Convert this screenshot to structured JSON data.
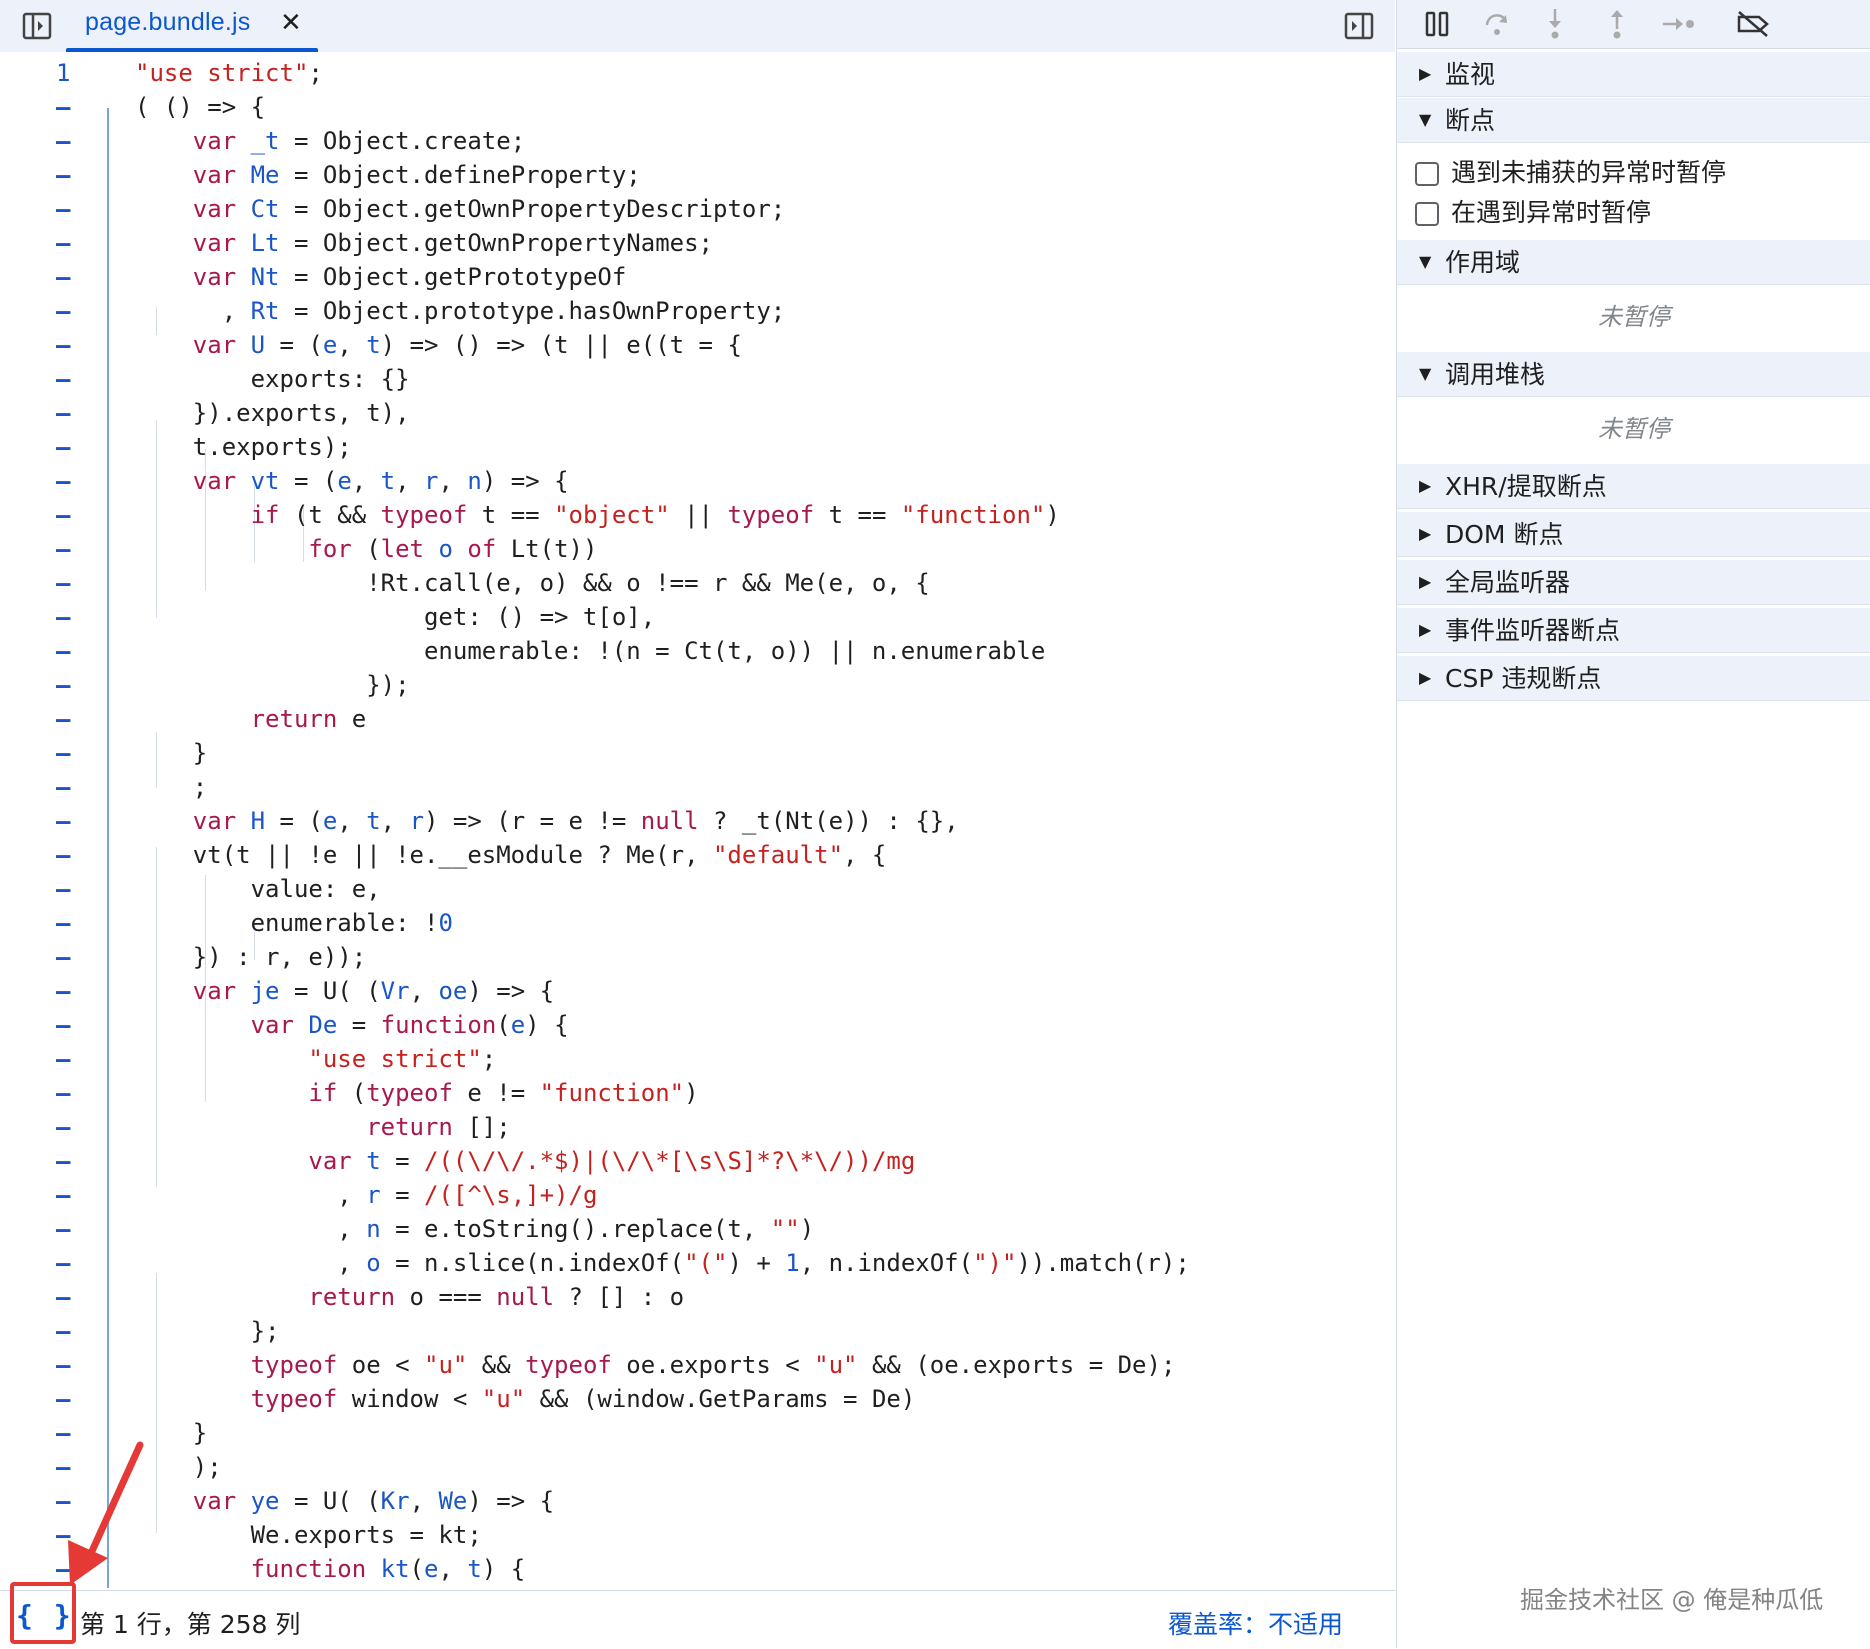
{
  "editor": {
    "tab_title": "page.bundle.js",
    "tab_close": "✕",
    "pretty_print": "{ }",
    "cursor_position": "第 1 行，第 258 列",
    "coverage": "覆盖率：不适用"
  },
  "code": {
    "first_line_number": "1",
    "fold_marker": "–",
    "lines": [
      [
        [
          "str",
          "\"use strict\""
        ],
        [
          "p",
          ";"
        ]
      ],
      [
        [
          "p",
          "( () => {"
        ]
      ],
      [
        [
          "p",
          "    "
        ],
        [
          "kw",
          "var"
        ],
        [
          "p",
          " "
        ],
        [
          "v",
          "_t"
        ],
        [
          "p",
          " = Object.create;"
        ]
      ],
      [
        [
          "p",
          "    "
        ],
        [
          "kw",
          "var"
        ],
        [
          "p",
          " "
        ],
        [
          "v",
          "Me"
        ],
        [
          "p",
          " = Object.defineProperty;"
        ]
      ],
      [
        [
          "p",
          "    "
        ],
        [
          "kw",
          "var"
        ],
        [
          "p",
          " "
        ],
        [
          "v",
          "Ct"
        ],
        [
          "p",
          " = Object.getOwnPropertyDescriptor;"
        ]
      ],
      [
        [
          "p",
          "    "
        ],
        [
          "kw",
          "var"
        ],
        [
          "p",
          " "
        ],
        [
          "v",
          "Lt"
        ],
        [
          "p",
          " = Object.getOwnPropertyNames;"
        ]
      ],
      [
        [
          "p",
          "    "
        ],
        [
          "kw",
          "var"
        ],
        [
          "p",
          " "
        ],
        [
          "v",
          "Nt"
        ],
        [
          "p",
          " = Object.getPrototypeOf"
        ]
      ],
      [
        [
          "p",
          "      , "
        ],
        [
          "v",
          "Rt"
        ],
        [
          "p",
          " = Object.prototype.hasOwnProperty;"
        ]
      ],
      [
        [
          "p",
          "    "
        ],
        [
          "kw",
          "var"
        ],
        [
          "p",
          " "
        ],
        [
          "v",
          "U"
        ],
        [
          "p",
          " = ("
        ],
        [
          "v",
          "e"
        ],
        [
          "p",
          ", "
        ],
        [
          "v",
          "t"
        ],
        [
          "p",
          ") => () => (t || e((t = {"
        ]
      ],
      [
        [
          "p",
          "        exports: {}"
        ]
      ],
      [
        [
          "p",
          "    }).exports, t),"
        ]
      ],
      [
        [
          "p",
          "    t.exports);"
        ]
      ],
      [
        [
          "p",
          "    "
        ],
        [
          "kw",
          "var"
        ],
        [
          "p",
          " "
        ],
        [
          "v",
          "vt"
        ],
        [
          "p",
          " = ("
        ],
        [
          "v",
          "e"
        ],
        [
          "p",
          ", "
        ],
        [
          "v",
          "t"
        ],
        [
          "p",
          ", "
        ],
        [
          "v",
          "r"
        ],
        [
          "p",
          ", "
        ],
        [
          "v",
          "n"
        ],
        [
          "p",
          ") => {"
        ]
      ],
      [
        [
          "p",
          "        "
        ],
        [
          "kw",
          "if"
        ],
        [
          "p",
          " (t && "
        ],
        [
          "kw",
          "typeof"
        ],
        [
          "p",
          " t == "
        ],
        [
          "str",
          "\"object\""
        ],
        [
          "p",
          " || "
        ],
        [
          "kw",
          "typeof"
        ],
        [
          "p",
          " t == "
        ],
        [
          "str",
          "\"function\""
        ],
        [
          "p",
          ")"
        ]
      ],
      [
        [
          "p",
          "            "
        ],
        [
          "kw",
          "for"
        ],
        [
          "p",
          " ("
        ],
        [
          "kw",
          "let"
        ],
        [
          "p",
          " "
        ],
        [
          "v",
          "o"
        ],
        [
          "p",
          " "
        ],
        [
          "kw",
          "of"
        ],
        [
          "p",
          " Lt(t))"
        ]
      ],
      [
        [
          "p",
          "                !Rt.call(e, o) && o !== r && Me(e, o, {"
        ]
      ],
      [
        [
          "p",
          "                    get: () => t[o],"
        ]
      ],
      [
        [
          "p",
          "                    enumerable: !(n = Ct(t, o)) || n.enumerable"
        ]
      ],
      [
        [
          "p",
          "                });"
        ]
      ],
      [
        [
          "p",
          "        "
        ],
        [
          "kw",
          "return"
        ],
        [
          "p",
          " e"
        ]
      ],
      [
        [
          "p",
          "    }"
        ]
      ],
      [
        [
          "p",
          "    ;"
        ]
      ],
      [
        [
          "p",
          "    "
        ],
        [
          "kw",
          "var"
        ],
        [
          "p",
          " "
        ],
        [
          "v",
          "H"
        ],
        [
          "p",
          " = ("
        ],
        [
          "v",
          "e"
        ],
        [
          "p",
          ", "
        ],
        [
          "v",
          "t"
        ],
        [
          "p",
          ", "
        ],
        [
          "v",
          "r"
        ],
        [
          "p",
          ") => (r = e != "
        ],
        [
          "kw",
          "null"
        ],
        [
          "p",
          " ? _t(Nt(e)) : {},"
        ]
      ],
      [
        [
          "p",
          "    vt(t || !e || !e.__esModule ? Me(r, "
        ],
        [
          "str",
          "\"default\""
        ],
        [
          "p",
          ", {"
        ]
      ],
      [
        [
          "p",
          "        value: e,"
        ]
      ],
      [
        [
          "p",
          "        enumerable: !"
        ],
        [
          "num",
          "0"
        ]
      ],
      [
        [
          "p",
          "    }) : r, e));"
        ]
      ],
      [
        [
          "p",
          "    "
        ],
        [
          "kw",
          "var"
        ],
        [
          "p",
          " "
        ],
        [
          "v",
          "je"
        ],
        [
          "p",
          " = U( ("
        ],
        [
          "v",
          "Vr"
        ],
        [
          "p",
          ", "
        ],
        [
          "v",
          "oe"
        ],
        [
          "p",
          ") => {"
        ]
      ],
      [
        [
          "p",
          "        "
        ],
        [
          "kw",
          "var"
        ],
        [
          "p",
          " "
        ],
        [
          "v",
          "De"
        ],
        [
          "p",
          " = "
        ],
        [
          "kw",
          "function"
        ],
        [
          "p",
          "("
        ],
        [
          "v",
          "e"
        ],
        [
          "p",
          ") {"
        ]
      ],
      [
        [
          "p",
          "            "
        ],
        [
          "str",
          "\"use strict\""
        ],
        [
          "p",
          ";"
        ]
      ],
      [
        [
          "p",
          "            "
        ],
        [
          "kw",
          "if"
        ],
        [
          "p",
          " ("
        ],
        [
          "kw",
          "typeof"
        ],
        [
          "p",
          " e != "
        ],
        [
          "str",
          "\"function\""
        ],
        [
          "p",
          ")"
        ]
      ],
      [
        [
          "p",
          "                "
        ],
        [
          "kw",
          "return"
        ],
        [
          "p",
          " [];"
        ]
      ],
      [
        [
          "p",
          "            "
        ],
        [
          "kw",
          "var"
        ],
        [
          "p",
          " "
        ],
        [
          "v",
          "t"
        ],
        [
          "p",
          " = "
        ],
        [
          "str",
          "/((\\/\\/.*$)|(\\/\\*[\\s\\S]*?\\*\\/))/mg"
        ]
      ],
      [
        [
          "p",
          "              , "
        ],
        [
          "v",
          "r"
        ],
        [
          "p",
          " = "
        ],
        [
          "str",
          "/([^\\s,]+)/g"
        ]
      ],
      [
        [
          "p",
          "              , "
        ],
        [
          "v",
          "n"
        ],
        [
          "p",
          " = e.toString().replace(t, "
        ],
        [
          "str",
          "\"\""
        ],
        [
          "p",
          ")"
        ]
      ],
      [
        [
          "p",
          "              , "
        ],
        [
          "v",
          "o"
        ],
        [
          "p",
          " = n.slice(n.indexOf("
        ],
        [
          "str",
          "\"(\""
        ],
        [
          "p",
          ") + "
        ],
        [
          "num",
          "1"
        ],
        [
          "p",
          ", n.indexOf("
        ],
        [
          "str",
          "\")\""
        ],
        [
          "p",
          ")).match(r);"
        ]
      ],
      [
        [
          "p",
          "            "
        ],
        [
          "kw",
          "return"
        ],
        [
          "p",
          " o === "
        ],
        [
          "kw",
          "null"
        ],
        [
          "p",
          " ? [] : o"
        ]
      ],
      [
        [
          "p",
          "        };"
        ]
      ],
      [
        [
          "p",
          "        "
        ],
        [
          "kw",
          "typeof"
        ],
        [
          "p",
          " oe < "
        ],
        [
          "str",
          "\"u\""
        ],
        [
          "p",
          " && "
        ],
        [
          "kw",
          "typeof"
        ],
        [
          "p",
          " oe.exports < "
        ],
        [
          "str",
          "\"u\""
        ],
        [
          "p",
          " && (oe.exports = De);"
        ]
      ],
      [
        [
          "p",
          "        "
        ],
        [
          "kw",
          "typeof"
        ],
        [
          "p",
          " window < "
        ],
        [
          "str",
          "\"u\""
        ],
        [
          "p",
          " && (window.GetParams = De)"
        ]
      ],
      [
        [
          "p",
          "    }"
        ]
      ],
      [
        [
          "p",
          "    );"
        ]
      ],
      [
        [
          "p",
          "    "
        ],
        [
          "kw",
          "var"
        ],
        [
          "p",
          " "
        ],
        [
          "v",
          "ye"
        ],
        [
          "p",
          " = U( ("
        ],
        [
          "v",
          "Kr"
        ],
        [
          "p",
          ", "
        ],
        [
          "v",
          "We"
        ],
        [
          "p",
          ") => {"
        ]
      ],
      [
        [
          "p",
          "        We.exports = kt;"
        ]
      ],
      [
        [
          "p",
          "        "
        ],
        [
          "kw",
          "function"
        ],
        [
          "p",
          " "
        ],
        [
          "v",
          "kt"
        ],
        [
          "p",
          "("
        ],
        [
          "v",
          "e"
        ],
        [
          "p",
          ", "
        ],
        [
          "v",
          "t"
        ],
        [
          "p",
          ") {"
        ]
      ]
    ]
  },
  "sidebar": {
    "sections": {
      "watch": "监视",
      "breakpoints": "断点",
      "scope": "作用域",
      "call_stack": "调用堆栈",
      "xhr": "XHR/提取断点",
      "dom": "DOM 断点",
      "global_listeners": "全局监听器",
      "event_listener_bp": "事件监听器断点",
      "csp": "CSP 违规断点"
    },
    "checkboxes": {
      "uncaught": "遇到未捕获的异常时暂停",
      "caught": "在遇到异常时暂停"
    },
    "not_paused": "未暂停",
    "collapsed_arrow": "▶",
    "expanded_arrow": "▼"
  },
  "colors": {
    "accent": "#0b57d0",
    "keyword": "#a8184d",
    "string": "#c5221f",
    "variable": "#1a56c8",
    "toolbar_bg": "#edf2fa",
    "annotation_red": "#e53935"
  },
  "watermark": "掘金技术社区 @ 俺是种瓜低"
}
